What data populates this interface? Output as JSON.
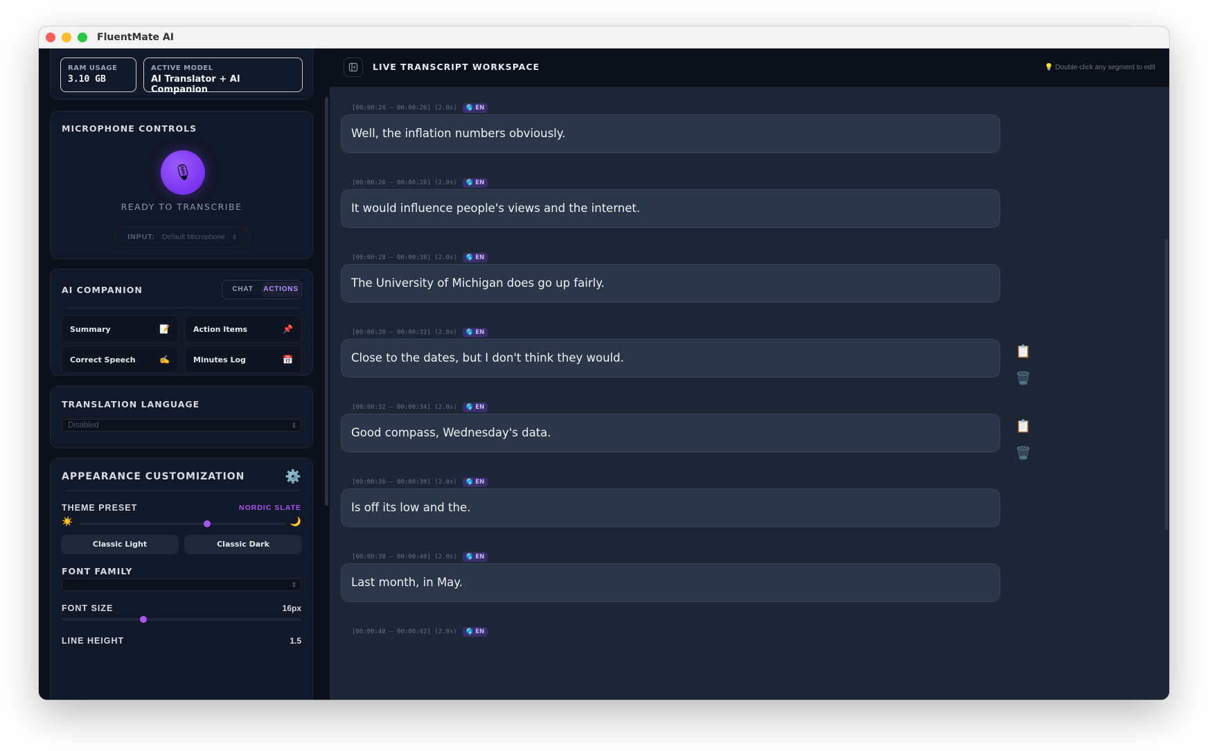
{
  "app": {
    "title": "FluentMate AI"
  },
  "stats": {
    "ram_label": "RAM USAGE",
    "ram_value": "3.10 GB",
    "model_label": "ACTIVE MODEL",
    "model_value": "AI Translator + AI Companion"
  },
  "microphone": {
    "title": "MICROPHONE CONTROLS",
    "status": "READY TO TRANSCRIBE",
    "input_label": "INPUT:",
    "input_value": "Default Microphone",
    "icon": "🎙"
  },
  "companion": {
    "title": "AI COMPANION",
    "tabs": [
      "CHAT",
      "ACTIONS"
    ],
    "active_tab": "ACTIONS",
    "actions": [
      {
        "label": "Summary",
        "icon": "📝"
      },
      {
        "label": "Action Items",
        "icon": "📌"
      },
      {
        "label": "Correct Speech",
        "icon": "✍️"
      },
      {
        "label": "Minutes Log",
        "icon": "📅"
      }
    ]
  },
  "translation": {
    "title": "TRANSLATION LANGUAGE",
    "value": "Disabled"
  },
  "appearance": {
    "title": "APPEARANCE CUSTOMIZATION",
    "gear_icon": "⚙️",
    "theme_label": "THEME PRESET",
    "theme_value": "NORDIC SLATE",
    "theme_level": 0.62,
    "sun_icon": "☀️",
    "moon_icon": "🌙",
    "light_button": "Classic Light",
    "dark_button": "Classic Dark",
    "font_family_label": "FONT FAMILY",
    "font_family_value": "",
    "font_size_label": "FONT SIZE",
    "font_size_value": "16px",
    "font_size_level": 0.34,
    "line_height_label": "LINE HEIGHT",
    "line_height_value": "1.5"
  },
  "workspace": {
    "title": "LIVE TRANSCRIPT WORKSPACE",
    "hint": "💡 Double-click any segment to edit",
    "segments": [
      {
        "time": "[00:00:24 – 00:00:26] (2.0s)",
        "lang": "🌎 EN",
        "text": "Well, the inflation numbers obviously."
      },
      {
        "time": "[00:00:26 – 00:00:28] (2.0s)",
        "lang": "🌎 EN",
        "text": "It would influence people's views and the internet."
      },
      {
        "time": "[00:00:28 – 00:00:30] (2.0s)",
        "lang": "🌎 EN",
        "text": "The University of Michigan does go up fairly."
      },
      {
        "time": "[00:00:30 – 00:00:32] (2.0s)",
        "lang": "🌎 EN",
        "text": "Close to the dates, but I don't think they would."
      },
      {
        "time": "[00:00:32 – 00:00:34] (2.0s)",
        "lang": "🌎 EN",
        "text": "Good compass, Wednesday's data."
      },
      {
        "time": "[00:00:36 – 00:00:38] (2.0s)",
        "lang": "🌎 EN",
        "text": "Is off its low and the."
      },
      {
        "time": "[00:00:38 – 00:00:40] (2.0s)",
        "lang": "🌎 EN",
        "text": "Last month, in May."
      },
      {
        "time": "[00:00:40 – 00:00:42] (2.0s)",
        "lang": "🌎 EN",
        "text": ""
      }
    ],
    "copy_icon": "📋",
    "delete_icon": "🗑️"
  },
  "colors": {
    "accent": "#a855f7",
    "close": "#ff5f57",
    "minimize": "#febc2e",
    "maximize": "#28c840"
  }
}
